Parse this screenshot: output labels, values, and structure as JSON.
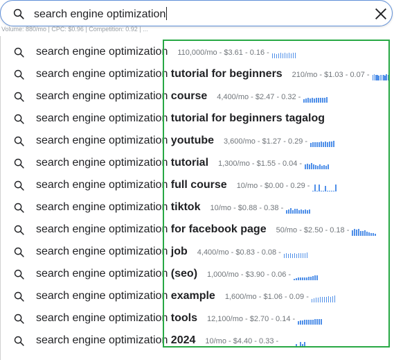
{
  "search": {
    "query": "search engine optimization",
    "peek_text": "Volume: 880/mo | CPC: $0.96 | Competition: 0.92 | ..."
  },
  "suggestions": [
    {
      "prefix": "search engine optimization",
      "suffix": "",
      "metric": "110,000/mo - $3.61 - 0.16 -",
      "trend": [
        0.55,
        0.6,
        0.5,
        0.6,
        0.65,
        0.6,
        0.7,
        0.6,
        0.65,
        0.6,
        0.7,
        0.65
      ]
    },
    {
      "prefix": "search engine optimization",
      "suffix": " tutorial for beginners",
      "metric": "210/mo - $1.03 - 0.07 -",
      "trend": [
        0.7,
        0.75,
        0.65,
        0.7,
        0.6,
        0.7,
        0.65,
        0.7,
        0.6,
        0.75,
        0.7,
        0.6
      ]
    },
    {
      "prefix": "search engine optimization",
      "suffix": " course",
      "metric": "4,400/mo - $2.47 - 0.32 -",
      "trend": [
        0.45,
        0.5,
        0.55,
        0.5,
        0.55,
        0.5,
        0.55,
        0.6,
        0.55,
        0.6,
        0.55,
        0.65
      ]
    },
    {
      "prefix": "search engine optimization",
      "suffix": " tutorial for beginners tagalog",
      "metric": "",
      "trend": []
    },
    {
      "prefix": "search engine optimization",
      "suffix": " youtube",
      "metric": "3,600/mo - $1.27 - 0.29 -",
      "trend": [
        0.5,
        0.55,
        0.6,
        0.55,
        0.6,
        0.65,
        0.6,
        0.65,
        0.6,
        0.7,
        0.65,
        0.75
      ]
    },
    {
      "prefix": "search engine optimization",
      "suffix": " tutorial",
      "metric": "1,300/mo - $1.55 - 0.04 -",
      "trend": [
        0.55,
        0.7,
        0.6,
        0.75,
        0.55,
        0.5,
        0.45,
        0.55,
        0.45,
        0.5,
        0.45,
        0.6
      ]
    },
    {
      "prefix": "search engine optimization",
      "suffix": " full course",
      "metric": "10/mo - $0.00 - 0.29 -",
      "trend": [
        0.05,
        0.8,
        0.05,
        0.8,
        0.05,
        0.05,
        0.7,
        0.05,
        0.05,
        0.05,
        0.05,
        0.85
      ]
    },
    {
      "prefix": "search engine optimization",
      "suffix": " tiktok",
      "metric": "10/mo - $0.88 - 0.38 -",
      "trend": [
        0.4,
        0.5,
        0.7,
        0.45,
        0.55,
        0.6,
        0.45,
        0.5,
        0.45,
        0.5,
        0.45,
        0.5
      ]
    },
    {
      "prefix": "search engine optimization",
      "suffix": " for facebook page",
      "metric": "50/mo - $2.50 - 0.18 -",
      "trend": [
        0.7,
        0.8,
        0.75,
        0.85,
        0.6,
        0.55,
        0.7,
        0.5,
        0.45,
        0.35,
        0.3,
        0.25
      ]
    },
    {
      "prefix": "search engine optimization",
      "suffix": " job",
      "metric": "4,400/mo - $0.83 - 0.08 -",
      "trend": [
        0.5,
        0.55,
        0.5,
        0.55,
        0.5,
        0.55,
        0.5,
        0.6,
        0.55,
        0.6,
        0.6,
        0.65
      ]
    },
    {
      "prefix": "search engine optimization",
      "suffix": " (seo)",
      "metric": "1,000/mo - $3.90 - 0.06 -",
      "trend": [
        0.2,
        0.25,
        0.3,
        0.3,
        0.35,
        0.3,
        0.35,
        0.4,
        0.45,
        0.5,
        0.55,
        0.6
      ]
    },
    {
      "prefix": "search engine optimization",
      "suffix": " example",
      "metric": "1,600/mo - $1.06 - 0.09 -",
      "trend": [
        0.45,
        0.5,
        0.55,
        0.6,
        0.65,
        0.7,
        0.65,
        0.7,
        0.75,
        0.7,
        0.75,
        0.8
      ]
    },
    {
      "prefix": "search engine optimization",
      "suffix": " tools",
      "metric": "12,100/mo - $2.70 - 0.14 -",
      "trend": [
        0.45,
        0.5,
        0.5,
        0.55,
        0.55,
        0.6,
        0.6,
        0.6,
        0.65,
        0.65,
        0.7,
        0.7
      ]
    },
    {
      "prefix": "search engine optimization",
      "suffix": " 2024",
      "metric": "10/mo - $4.40 - 0.33 -",
      "trend": [
        0.05,
        0.05,
        0.05,
        0.05,
        0.05,
        0.05,
        0.05,
        0.3,
        0.05,
        0.55,
        0.35,
        0.6
      ]
    }
  ],
  "colors": {
    "trend_bar": "#4f8fe8",
    "highlight_box": "#27a844",
    "search_border": "#5f8fd8"
  }
}
